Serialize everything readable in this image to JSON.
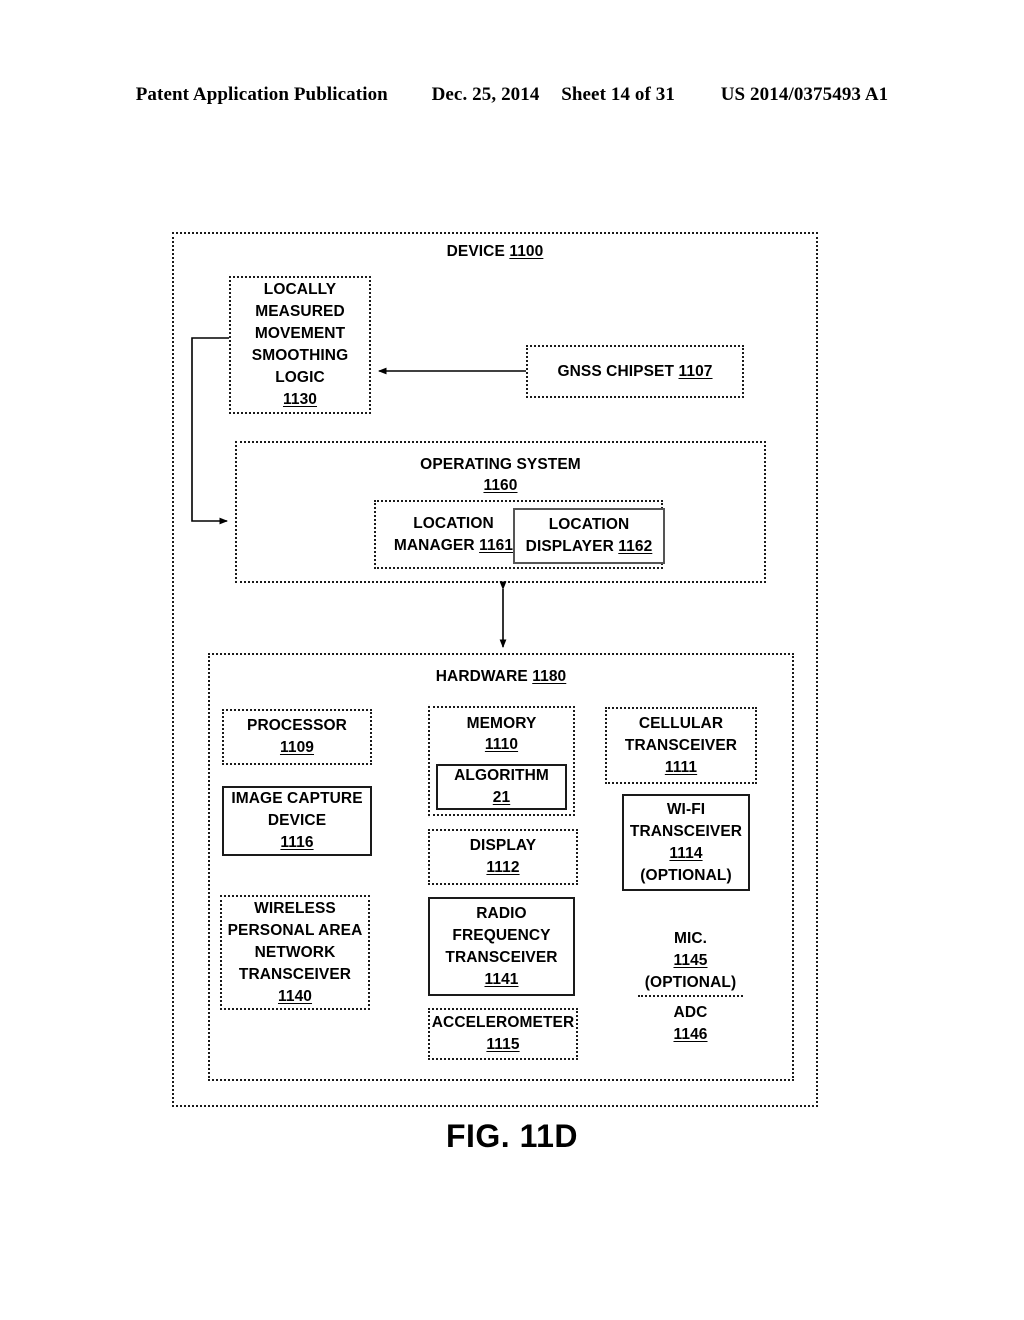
{
  "header": {
    "publication": "Patent Application Publication",
    "date": "Dec. 25, 2014",
    "sheet": "Sheet 14 of 31",
    "patent_number": "US 2014/0375493 A1"
  },
  "figure": {
    "caption": "FIG. 11D"
  },
  "diagram": {
    "device": {
      "title_text": "DEVICE",
      "title_ref": "1100"
    },
    "smoothing_logic": {
      "line1": "LOCALLY",
      "line2": "MEASURED",
      "line3": "MOVEMENT",
      "line4": "SMOOTHING",
      "line5": "LOGIC",
      "ref": "1130"
    },
    "gnss_chipset": {
      "label": "GNSS CHIPSET",
      "ref": "1107"
    },
    "operating_system": {
      "title_text": "OPERATING SYSTEM",
      "title_ref": "1160",
      "location_manager": {
        "line1": "LOCATION",
        "line2": "MANAGER",
        "ref": "1161"
      },
      "location_displayer": {
        "line1": "LOCATION",
        "line2": "DISPLAYER",
        "ref": "1162"
      }
    },
    "hardware": {
      "title_text": "HARDWARE",
      "title_ref": "1180",
      "processor": {
        "line1": "PROCESSOR",
        "ref": "1109"
      },
      "image_capture_device": {
        "line1": "IMAGE CAPTURE",
        "line2": "DEVICE",
        "ref": "1116"
      },
      "wpan_transceiver": {
        "line1": "WIRELESS",
        "line2": "PERSONAL AREA",
        "line3": "NETWORK",
        "line4": "TRANSCEIVER",
        "ref": "1140"
      },
      "memory": {
        "line1": "MEMORY",
        "ref": "1110",
        "algorithm": {
          "line1": "ALGORITHM",
          "ref": "21"
        }
      },
      "display": {
        "line1": "DISPLAY",
        "ref": "1112"
      },
      "rf_transceiver": {
        "line1": "RADIO",
        "line2": "FREQUENCY",
        "line3": "TRANSCEIVER",
        "ref": "1141"
      },
      "accelerometer": {
        "line1": "ACCELEROMETER",
        "ref": "1115"
      },
      "cellular_transceiver": {
        "line1": "CELLULAR",
        "line2": "TRANSCEIVER",
        "ref": "1111"
      },
      "wifi_transceiver": {
        "line1": "WI-FI",
        "line2": "TRANSCEIVER",
        "ref": "1114",
        "note": "(OPTIONAL)"
      },
      "mic": {
        "line1": "MIC.",
        "ref": "1145",
        "note": "(OPTIONAL)"
      },
      "adc": {
        "line1": "ADC",
        "ref": "1146"
      }
    }
  },
  "colors": {
    "ink": "#000000",
    "paper": "#ffffff"
  }
}
